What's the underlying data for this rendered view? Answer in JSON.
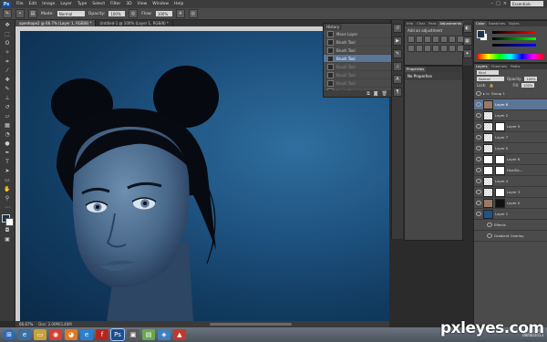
{
  "app": {
    "logo": "Ps",
    "workspace": "Essentials"
  },
  "menu": [
    "File",
    "Edit",
    "Image",
    "Layer",
    "Type",
    "Select",
    "Filter",
    "3D",
    "View",
    "Window",
    "Help"
  ],
  "options": {
    "mode_label": "Mode:",
    "mode_value": "Normal",
    "opacity_label": "Opacity:",
    "opacity_value": "100%",
    "flow_label": "Flow:",
    "flow_value": "100%"
  },
  "doc_tabs": [
    {
      "label": "openhope2 @ 66.7% (Layer 1, RGB/8) *"
    },
    {
      "label": "Untitled-1 @ 100% (Layer 1, RGB/8) *"
    }
  ],
  "status": {
    "zoom": "66.67%",
    "doc": "Doc: 2.00M/3.40M"
  },
  "history": {
    "tab": "History",
    "items": [
      {
        "label": "Move Layer",
        "state": "normal"
      },
      {
        "label": "Brush Tool",
        "state": "normal"
      },
      {
        "label": "Brush Tool",
        "state": "normal"
      },
      {
        "label": "Brush Tool",
        "state": "selected"
      },
      {
        "label": "Brush Tool",
        "state": "dim"
      },
      {
        "label": "Brush Tool",
        "state": "dim"
      },
      {
        "label": "Brush Tool",
        "state": "dim"
      },
      {
        "label": "Brush Tool",
        "state": "dim"
      }
    ]
  },
  "adjustments": {
    "tabs": [
      "Info",
      "Char",
      "Para",
      "Adjustments"
    ],
    "title": "Add an adjustment"
  },
  "properties": {
    "tab": "Properties",
    "title": "No Properties"
  },
  "color": {
    "tabs": [
      "Color",
      "Swatches",
      "Styles"
    ],
    "fg": "#1a3550",
    "bg": "#ffffff"
  },
  "layers": {
    "tabs": [
      "Layers",
      "Channels",
      "Paths"
    ],
    "kind": "Kind",
    "blend": "Normal",
    "opacity_label": "Opacity:",
    "opacity": "100%",
    "lock_label": "Lock:",
    "fill_label": "Fill:",
    "fill": "100%",
    "rows": [
      {
        "name": "Group 1",
        "thumb": "group",
        "mask": "",
        "sel": false
      },
      {
        "name": "Layer 8",
        "thumb": "photo",
        "mask": "",
        "sel": true
      },
      {
        "name": "Layer 2",
        "thumb": "checker",
        "mask": "",
        "sel": false
      },
      {
        "name": "Layer 9",
        "thumb": "checker",
        "mask": "white",
        "sel": false
      },
      {
        "name": "Layer 7",
        "thumb": "checker",
        "mask": "",
        "sel": false
      },
      {
        "name": "Layer 5",
        "thumb": "checker",
        "mask": "",
        "sel": false
      },
      {
        "name": "Layer 6",
        "thumb": "white",
        "mask": "white",
        "sel": false
      },
      {
        "name": "Hue/Sa...",
        "thumb": "white",
        "mask": "white",
        "sel": false
      },
      {
        "name": "Layer 4",
        "thumb": "checker",
        "mask": "",
        "sel": false
      },
      {
        "name": "Layer 3",
        "thumb": "checker",
        "mask": "white",
        "sel": false
      },
      {
        "name": "Layer 0",
        "thumb": "photo",
        "mask": "dark",
        "sel": false
      },
      {
        "name": "Layer 1",
        "thumb": "blue",
        "mask": "",
        "sel": false
      },
      {
        "name": "Effects",
        "thumb": "",
        "mask": "",
        "sel": false
      },
      {
        "name": "Gradient Overlay",
        "thumb": "",
        "mask": "",
        "sel": false
      }
    ]
  },
  "taskbar": {
    "apps": [
      "start",
      "explorer",
      "folder",
      "chrome",
      "firefox",
      "ie",
      "flash",
      "photoshop",
      "app9",
      "app10",
      "app11",
      "app12"
    ],
    "time": "10:12 AM",
    "date": "08/06/2013"
  },
  "watermark": "pxleyes.com"
}
